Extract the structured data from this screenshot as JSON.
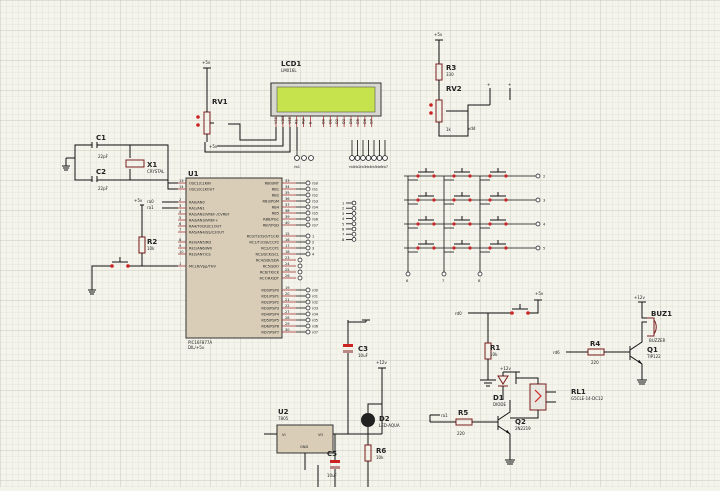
{
  "grid": {
    "minor": "#d6d6c8",
    "major": "#bcbcae",
    "background": "#f4f4ec"
  },
  "colors": {
    "wire": "#111111",
    "component": "#7a1c1c",
    "ic_body": "#d9cdb8",
    "lcd_screen": "#c6e24c",
    "switch_red": "#cc2222",
    "pin": "#993333",
    "led": "#222222"
  },
  "components": {
    "lcd": {
      "ref": "LCD1",
      "model": "LM016L",
      "pins": [
        "VSS",
        "VDD",
        "VEE",
        "RS",
        "RW",
        "E",
        "D0",
        "D1",
        "D2",
        "D3",
        "D4",
        "D5",
        "D6",
        "D7"
      ]
    },
    "rv1": {
      "ref": "RV1"
    },
    "rv2": {
      "ref": "RV2",
      "val": "1k"
    },
    "r3": {
      "ref": "R3",
      "val": "330"
    },
    "c1": {
      "ref": "C1",
      "val": "22pF"
    },
    "c2": {
      "ref": "C2",
      "val": "22pF"
    },
    "x1": {
      "ref": "X1",
      "val": "CRYSTAL"
    },
    "r2": {
      "ref": "R2",
      "val": "10k"
    },
    "u1": {
      "ref": "U1",
      "model": "PIC16F877A",
      "sub": "DIL/+5v",
      "left_pins": [
        {
          "n": "13",
          "t": "OSC1/CLKIN"
        },
        {
          "n": "14",
          "t": "OSC2/CLKOUT"
        },
        {
          "n": "2",
          "t": "RA0/AN0"
        },
        {
          "n": "3",
          "t": "RA1/AN1"
        },
        {
          "n": "4",
          "t": "RA2/AN2/VREF-/CVREF"
        },
        {
          "n": "5",
          "t": "RA3/AN3/VREF+"
        },
        {
          "n": "6",
          "t": "RA4/T0CKI/C1OUT"
        },
        {
          "n": "7",
          "t": "RA5/AN4/SS/C2OUT"
        },
        {
          "n": "8",
          "t": "RE0/AN5/RD"
        },
        {
          "n": "9",
          "t": "RE1/AN6/WR"
        },
        {
          "n": "10",
          "t": "RE2/AN7/CS"
        },
        {
          "n": "1",
          "t": "MCLR/Vpp/THV"
        }
      ],
      "right_pins": [
        {
          "n": "33",
          "t": "RB0/INT",
          "net": "rb0"
        },
        {
          "n": "34",
          "t": "RB1",
          "net": "rb1"
        },
        {
          "n": "35",
          "t": "RB2",
          "net": "rb2"
        },
        {
          "n": "36",
          "t": "RB3/PGM",
          "net": "rb3"
        },
        {
          "n": "37",
          "t": "RB4",
          "net": "rb4"
        },
        {
          "n": "38",
          "t": "RB5",
          "net": "rb5"
        },
        {
          "n": "39",
          "t": "RB6/PGC",
          "net": "rb6"
        },
        {
          "n": "40",
          "t": "RB7/PGD",
          "net": "rb7"
        },
        {
          "n": "15",
          "t": "RC0/T1OSO/T1CKI",
          "net": "1"
        },
        {
          "n": "16",
          "t": "RC1/T1OSI/CCP2",
          "net": "2"
        },
        {
          "n": "17",
          "t": "RC2/CCP1",
          "net": "3"
        },
        {
          "n": "18",
          "t": "RC3/SCK/SCL",
          "net": "4"
        },
        {
          "n": "23",
          "t": "RC4/SDI/SDA",
          "net": ""
        },
        {
          "n": "24",
          "t": "RC5/SDO",
          "net": ""
        },
        {
          "n": "25",
          "t": "RC6/TX/CK",
          "net": ""
        },
        {
          "n": "26",
          "t": "RC7/RX/DT",
          "net": ""
        },
        {
          "n": "19",
          "t": "RD0/PSP0",
          "net": "rd0"
        },
        {
          "n": "20",
          "t": "RD1/PSP1",
          "net": "rd1"
        },
        {
          "n": "21",
          "t": "RD2/PSP2",
          "net": "rd2"
        },
        {
          "n": "22",
          "t": "RD3/PSP3",
          "net": "rd3"
        },
        {
          "n": "27",
          "t": "RD4/PSP4",
          "net": "rd4"
        },
        {
          "n": "28",
          "t": "RD5/PSP5",
          "net": "rd5"
        },
        {
          "n": "29",
          "t": "RD6/PSP6",
          "net": "rd6"
        },
        {
          "n": "30",
          "t": "RD7/PSP7",
          "net": "rd7"
        }
      ]
    },
    "u2": {
      "ref": "U2",
      "model": "7805",
      "vi": "VI",
      "vo": "VO",
      "gnd": "GND"
    },
    "c3": {
      "ref": "C3",
      "val": "10uF"
    },
    "c5": {
      "ref": "C5",
      "val": "10uF"
    },
    "d2": {
      "ref": "D2",
      "val": "LED-AQUA"
    },
    "r6": {
      "ref": "R6",
      "val": "10k"
    },
    "r1": {
      "ref": "R1",
      "val": "10k"
    },
    "d1": {
      "ref": "D1",
      "val": "DIODE"
    },
    "rl1": {
      "ref": "RL1",
      "val": "G5CLE-14-DC12"
    },
    "r5": {
      "ref": "R5",
      "val": "220"
    },
    "q2": {
      "ref": "Q2",
      "val": "2N2219"
    },
    "r4": {
      "ref": "R4",
      "val": "220"
    },
    "q1": {
      "ref": "Q1",
      "val": "TIP122"
    },
    "buz1": {
      "ref": "BUZ1",
      "val": "BUZZER"
    }
  },
  "nets": {
    "p5v": "+5v",
    "p12v": "+12v",
    "vdd": "vdd",
    "ra0": "ra0",
    "ra1": "ra1",
    "rd0": "rd0",
    "rd6": "rd6",
    "ra1b": "ra1",
    "lcd_nets": [
      "rb1",
      "rb0",
      "rb2",
      "rb3",
      "rb4",
      "rb5",
      "rb6",
      "rb7"
    ],
    "connector_rows": [
      "1",
      "2",
      "3",
      "4",
      "5",
      "6",
      "7",
      "8"
    ],
    "keypad_rows": [
      "2",
      "3",
      "4",
      "5"
    ],
    "keypad_cols": [
      "6",
      "7",
      "8"
    ]
  }
}
